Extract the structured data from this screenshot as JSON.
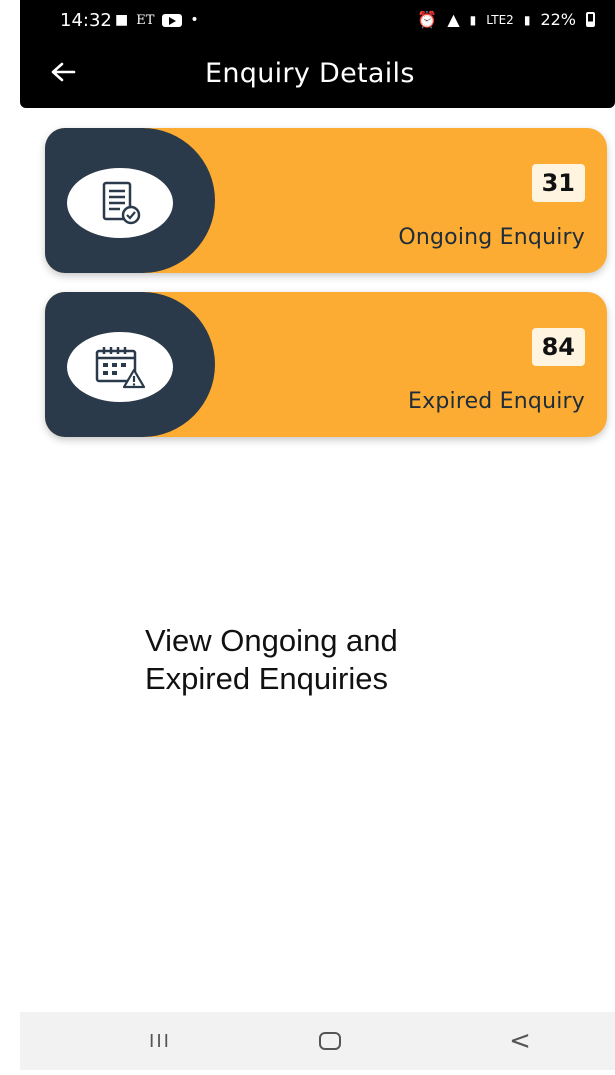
{
  "status_bar": {
    "time": "14:32",
    "left_icons": [
      "chat-icon",
      "et-icon",
      "youtube-icon",
      "dot-icon"
    ],
    "et_label": "ET",
    "battery": "22%",
    "right_icons": [
      "alarm-icon",
      "wifi-icon",
      "signal-icon",
      "volte-icon",
      "signal-icon",
      "battery-icon"
    ],
    "lte_label": "LTE2"
  },
  "app_bar": {
    "title": "Enquiry Details",
    "back_icon": "arrow-left-icon"
  },
  "cards": [
    {
      "count": "31",
      "label": "Ongoing Enquiry",
      "icon": "document-check-icon"
    },
    {
      "count": "84",
      "label": "Expired Enquiry",
      "icon": "calendar-warning-icon"
    }
  ],
  "caption": {
    "line1": "View Ongoing and",
    "line2": "Expired Enquiries"
  },
  "nav_bar": {
    "recents_glyph": "III",
    "back_glyph": "<"
  },
  "colors": {
    "card_orange": "#fcac32",
    "card_dark": "#2a3a4a",
    "app_bar": "#000000",
    "count_bg": "#fff4e0"
  }
}
